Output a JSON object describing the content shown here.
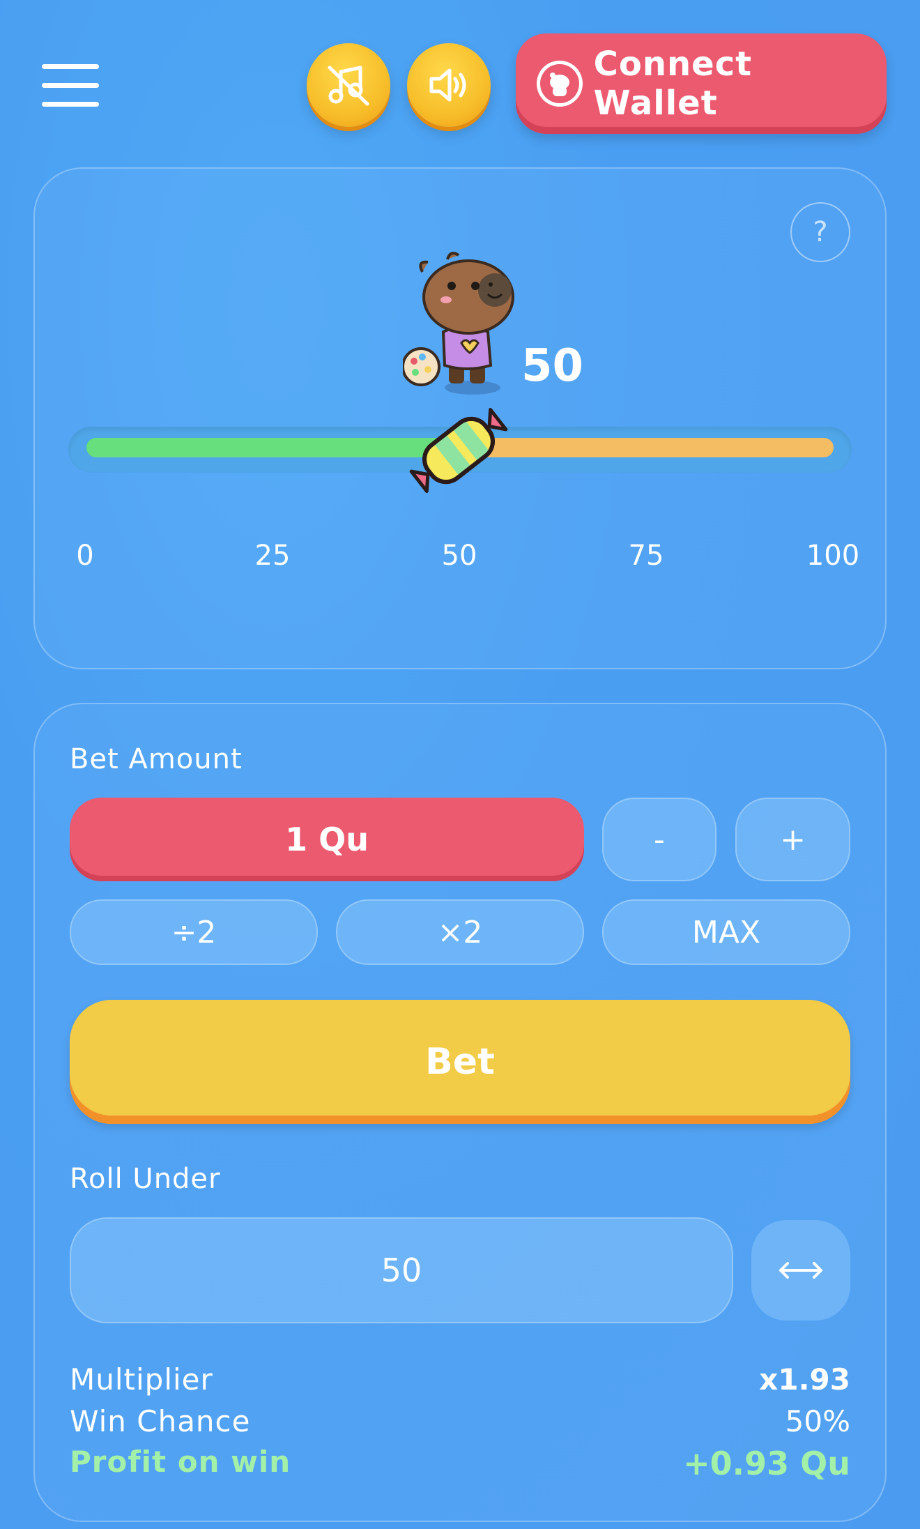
{
  "header": {
    "music_icon": "music-off-icon",
    "sound_icon": "speaker-on-icon",
    "wallet_label": "Connect Wallet"
  },
  "game": {
    "help_label": "?",
    "roll_value": "50",
    "slider_value": 50,
    "ticks": [
      "0",
      "25",
      "50",
      "75",
      "100"
    ],
    "colors": {
      "win": "#67df7c",
      "lose": "#f4bc63"
    }
  },
  "controls": {
    "bet_amount_label": "Bet Amount",
    "bet_amount_value": "1 Qu",
    "minus_label": "-",
    "plus_label": "+",
    "half_label": "÷2",
    "double_label": "×2",
    "max_label": "MAX",
    "bet_label": "Bet",
    "roll_under_label": "Roll Under",
    "roll_under_value": "50"
  },
  "stats": {
    "multiplier_label": "Multiplier",
    "multiplier_value": "x1.93",
    "win_chance_label": "Win Chance",
    "win_chance_value": "50%",
    "profit_label": "Profit on win",
    "profit_value": "+0.93 Qu"
  }
}
